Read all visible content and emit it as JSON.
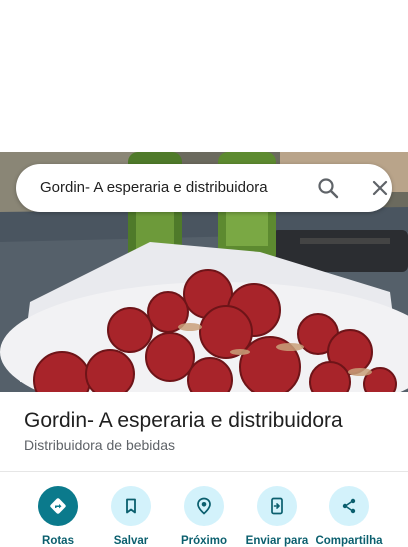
{
  "search": {
    "query": "Gordin- A esperaria e distribuidora",
    "search_icon": "search-icon",
    "close_icon": "close-icon"
  },
  "place": {
    "title": "Gordin- A esperaria e distribuidora",
    "category": "Distribuidora de bebidas"
  },
  "actions": [
    {
      "label": "Rotas",
      "icon": "directions-icon"
    },
    {
      "label": "Salvar",
      "icon": "bookmark-icon"
    },
    {
      "label": "Próximo",
      "icon": "nearby-icon"
    },
    {
      "label": "Enviar para",
      "icon": "send-to-phone-icon"
    },
    {
      "label": "Compartilha",
      "icon": "share-icon"
    }
  ],
  "colors": {
    "accent": "#0b7a8c",
    "button_bg": "#d3f2fb",
    "label": "#0b5f6e"
  }
}
